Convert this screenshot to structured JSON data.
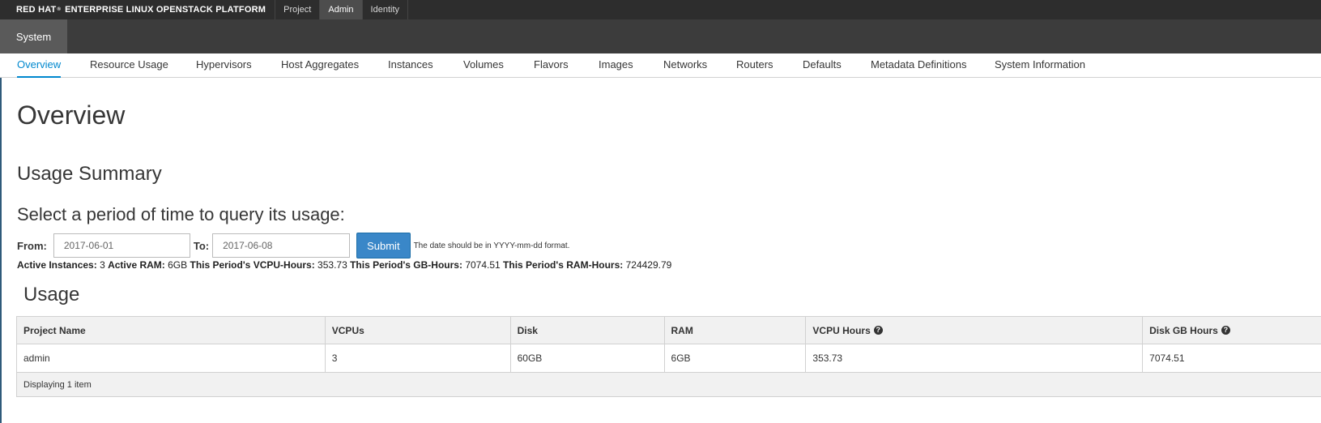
{
  "brand": {
    "redhat": "RED HAT",
    "registered": "®",
    "rest": "ENTERPRISE LINUX OPENSTACK PLATFORM"
  },
  "topnav": [
    "Project",
    "Admin",
    "Identity"
  ],
  "active_top": "Admin",
  "section_tab": "System",
  "tabs": [
    "Overview",
    "Resource Usage",
    "Hypervisors",
    "Host Aggregates",
    "Instances",
    "Volumes",
    "Flavors",
    "Images",
    "Networks",
    "Routers",
    "Defaults",
    "Metadata Definitions",
    "System Information"
  ],
  "active_tab": "Overview",
  "page_title": "Overview",
  "usage_summary_title": "Usage Summary",
  "period_title": "Select a period of time to query its usage:",
  "form": {
    "from_label": "From:",
    "from_value": "2017-06-01",
    "to_label": "To:",
    "to_value": "2017-06-08",
    "submit_label": "Submit",
    "hint": "The date should be in YYYY-mm-dd format."
  },
  "stats": {
    "active_instances_label": "Active Instances:",
    "active_instances": "3",
    "active_ram_label": "Active RAM:",
    "active_ram": "6GB",
    "vcpu_hours_label": "This Period's VCPU-Hours:",
    "vcpu_hours": "353.73",
    "gb_hours_label": "This Period's GB-Hours:",
    "gb_hours": "7074.51",
    "ram_hours_label": "This Period's RAM-Hours:",
    "ram_hours": "724429.79"
  },
  "usage_title": "Usage",
  "table": {
    "headers": [
      "Project Name",
      "VCPUs",
      "Disk",
      "RAM",
      "VCPU Hours",
      "Disk GB Hours"
    ],
    "rows": [
      [
        "admin",
        "3",
        "60GB",
        "6GB",
        "353.73",
        "7074.51"
      ]
    ],
    "footer": "Displaying 1 item"
  },
  "colors": {
    "accent": "#0088ce",
    "button": "#3a87c8",
    "topbar": "#2d2d2d",
    "secbar": "#3c3c3c"
  }
}
